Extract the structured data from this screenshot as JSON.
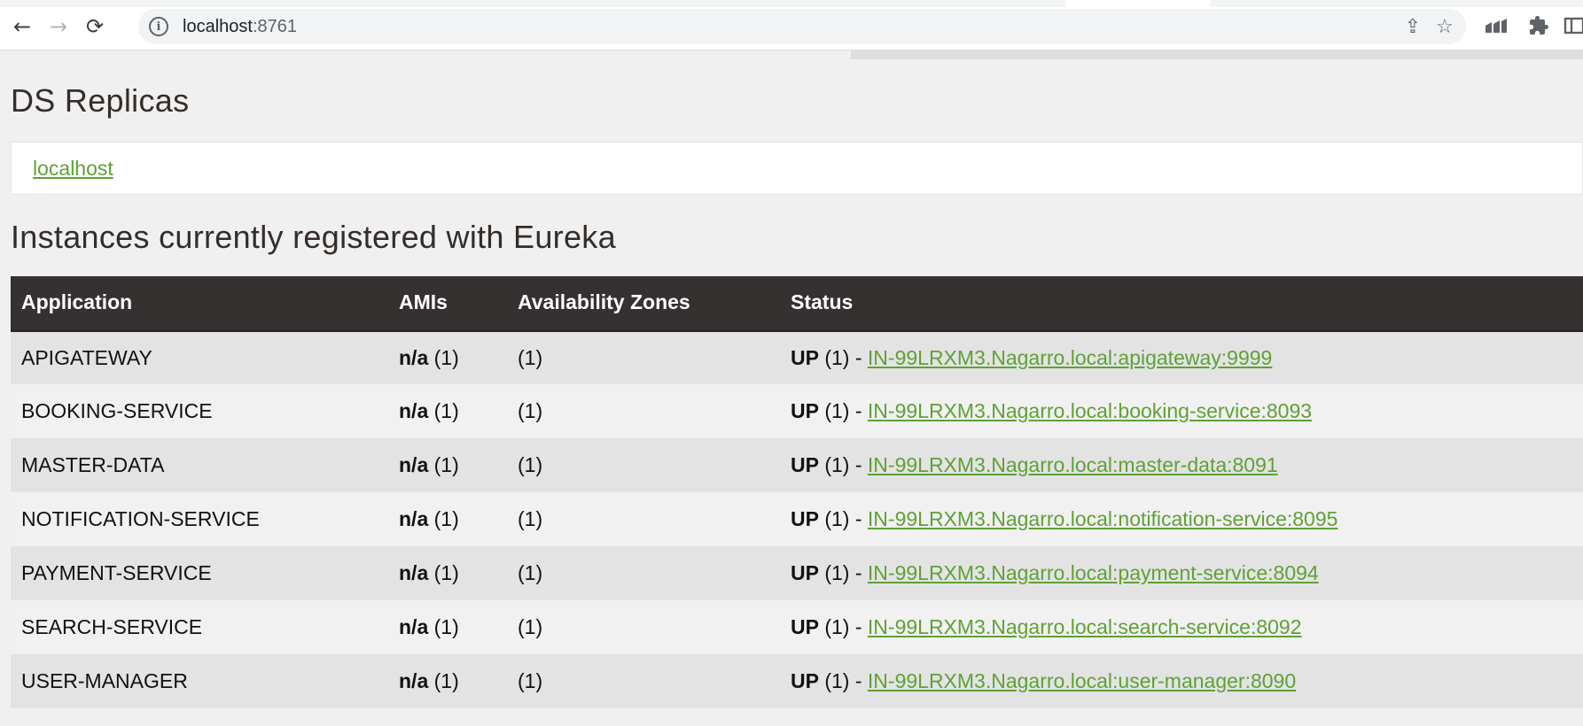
{
  "browser": {
    "url_host": "localhost",
    "url_port": ":8761",
    "back_icon": "←",
    "forward_icon": "→",
    "reload_icon": "⟳",
    "info_icon": "i",
    "share_icon": "⇪",
    "star_icon": "☆",
    "extension_icon": "⧉",
    "window_icon": "▢"
  },
  "replicas": {
    "heading": "DS Replicas",
    "link": "localhost"
  },
  "instances": {
    "heading": "Instances currently registered with Eureka",
    "columns": [
      "Application",
      "AMIs",
      "Availability Zones",
      "Status"
    ],
    "rows": [
      {
        "app": "APIGATEWAY",
        "ami_bold": "n/a",
        "ami_count": " (1)",
        "zones": "(1)",
        "status_bold": "UP",
        "status_rest": " (1) - ",
        "link": "IN-99LRXM3.Nagarro.local:apigateway:9999"
      },
      {
        "app": "BOOKING-SERVICE",
        "ami_bold": "n/a",
        "ami_count": " (1)",
        "zones": "(1)",
        "status_bold": "UP",
        "status_rest": " (1) - ",
        "link": "IN-99LRXM3.Nagarro.local:booking-service:8093"
      },
      {
        "app": "MASTER-DATA",
        "ami_bold": "n/a",
        "ami_count": " (1)",
        "zones": "(1)",
        "status_bold": "UP",
        "status_rest": " (1) - ",
        "link": "IN-99LRXM3.Nagarro.local:master-data:8091"
      },
      {
        "app": "NOTIFICATION-SERVICE",
        "ami_bold": "n/a",
        "ami_count": " (1)",
        "zones": "(1)",
        "status_bold": "UP",
        "status_rest": " (1) - ",
        "link": "IN-99LRXM3.Nagarro.local:notification-service:8095"
      },
      {
        "app": "PAYMENT-SERVICE",
        "ami_bold": "n/a",
        "ami_count": " (1)",
        "zones": "(1)",
        "status_bold": "UP",
        "status_rest": " (1) - ",
        "link": "IN-99LRXM3.Nagarro.local:payment-service:8094"
      },
      {
        "app": "SEARCH-SERVICE",
        "ami_bold": "n/a",
        "ami_count": " (1)",
        "zones": "(1)",
        "status_bold": "UP",
        "status_rest": " (1) - ",
        "link": "IN-99LRXM3.Nagarro.local:search-service:8092"
      },
      {
        "app": "USER-MANAGER",
        "ami_bold": "n/a",
        "ami_count": " (1)",
        "zones": "(1)",
        "status_bold": "UP",
        "status_rest": " (1) - ",
        "link": "IN-99LRXM3.Nagarro.local:user-manager:8090"
      }
    ]
  },
  "colors": {
    "link": "#5fa136",
    "header_bg": "#353130",
    "heading": "#342d2a"
  }
}
